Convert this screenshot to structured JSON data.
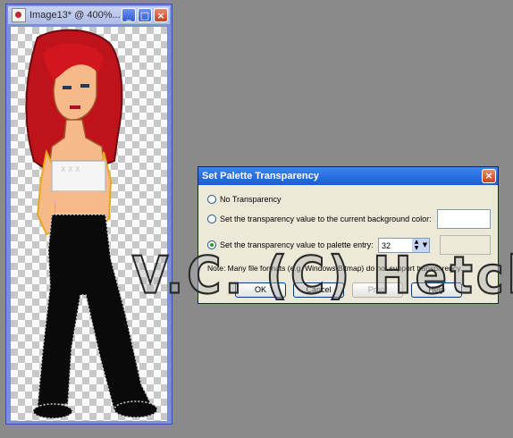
{
  "image_window": {
    "title": "Image13* @ 400%...",
    "buttons": {
      "minimize": "_",
      "maximize": "□",
      "close": "×"
    },
    "icon": "app-icon"
  },
  "dialog": {
    "title": "Set Palette Transparency",
    "close": "×",
    "options": [
      {
        "label": "No Transparency",
        "selected": false
      },
      {
        "label": "Set the transparency value to the current background color:",
        "selected": false
      },
      {
        "label": "Set the transparency value to palette entry:",
        "selected": true
      }
    ],
    "palette_entry": "32",
    "note": "Note: Many file formats (e.g. Windows Bitmap) do not support transparency.",
    "buttons": {
      "ok": "OK",
      "cancel": "Cancel",
      "proof": "Proof",
      "help": "Help"
    }
  },
  "watermark": "V.C. (C) Hetch",
  "colors": {
    "hair": "#c0121a",
    "skin": "#f7b98a",
    "top": "#f5f5f5",
    "pants": "#0a0a0a",
    "accent": "#e6a81e"
  }
}
